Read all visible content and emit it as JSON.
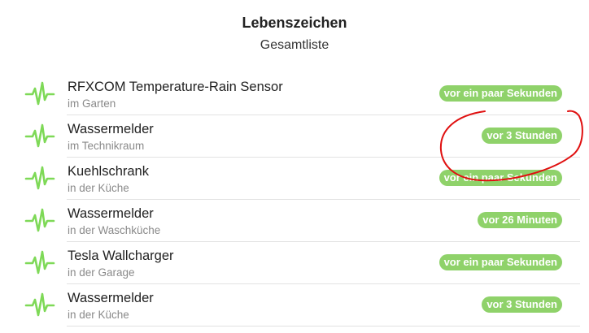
{
  "header": {
    "title": "Lebenszeichen",
    "subtitle": "Gesamtliste"
  },
  "colors": {
    "badge": "#8fd26a",
    "icon": "#7ed957",
    "annotation": "#e01010"
  },
  "items": [
    {
      "name": "RFXCOM Temperature-Rain Sensor",
      "location": "im Garten",
      "status": "vor ein paar Sekunden",
      "icon": "heartbeat-icon"
    },
    {
      "name": "Wassermelder",
      "location": "im Technikraum",
      "status": "vor 3 Stunden",
      "icon": "heartbeat-icon"
    },
    {
      "name": "Kuehlschrank",
      "location": "in der Küche",
      "status": "vor ein paar Sekunden",
      "icon": "heartbeat-icon"
    },
    {
      "name": "Wassermelder",
      "location": "in der Waschküche",
      "status": "vor 26 Minuten",
      "icon": "heartbeat-icon"
    },
    {
      "name": "Tesla Wallcharger",
      "location": "in der Garage",
      "status": "vor ein paar Sekunden",
      "icon": "heartbeat-icon"
    },
    {
      "name": "Wassermelder",
      "location": "in der Küche",
      "status": "vor 3 Stunden",
      "icon": "heartbeat-icon"
    }
  ]
}
